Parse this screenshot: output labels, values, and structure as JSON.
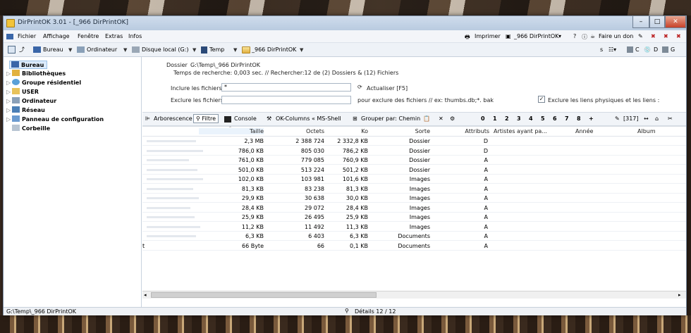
{
  "window": {
    "title": "DirPrintOK 3.01 - [_966 DirPrintOK]"
  },
  "menu": {
    "items": [
      "Fichier",
      "Affichage",
      "Fenêtre",
      "Extras",
      "Infos"
    ],
    "print": "Imprimer",
    "doc": "_966 DirPrintOK",
    "donate": "Faire un don"
  },
  "address": {
    "crumbs": [
      "Bureau",
      "Ordinateur",
      "Disque local (G:)",
      "Temp",
      "_966 DirPrintOK"
    ],
    "right_letters": [
      "C",
      "D",
      "G"
    ]
  },
  "tree": {
    "items": [
      "Bureau",
      "Bibliothèques",
      "Groupe résidentiel",
      "USER",
      "Ordinateur",
      "Réseau",
      "Panneau de configuration",
      "Corbeille"
    ]
  },
  "info": {
    "dossier_label": "Dossier",
    "dossier_value": "G:\\Temp\\_966 DirPrintOK",
    "search_time": "Temps de recherche: 0,003 sec. //  Rechercher:12 de (2) Dossiers & (12) Fichiers",
    "include_label": "Inclure les fichiers",
    "include_value": "*",
    "refresh": "Actualiser [F5]",
    "exclude_label": "Exclure les fichiers",
    "exclude_hint": "pour exclure des fichiers // ex: thumbs.db;*. bak",
    "exclude_links": "Exclure les liens physiques et les liens :"
  },
  "toolbar": {
    "tree": "Arborescence",
    "filter": "Filtre",
    "console": "Console",
    "columns": "OK-Columns « MS-Shell",
    "group": "Grouper par: Chemin",
    "digits": [
      "0",
      "1",
      "2",
      "3",
      "4",
      "5",
      "6",
      "7",
      "8",
      "+"
    ],
    "count": "[317]"
  },
  "columns": [
    "Taille",
    "Octets",
    "Ko",
    "Sorte",
    "Attributs",
    "Artistes ayant pa...",
    "Année",
    "Album"
  ],
  "rows": [
    {
      "taille": "2,3 MB",
      "octets": "2 388 724",
      "ko": "2 332,8 KB",
      "sorte": "Dossier",
      "attr": "D"
    },
    {
      "taille": "786,0 KB",
      "octets": "805 030",
      "ko": "786,2 KB",
      "sorte": "Dossier",
      "attr": "D"
    },
    {
      "taille": "761,0 KB",
      "octets": "779 085",
      "ko": "760,9 KB",
      "sorte": "Dossier",
      "attr": "A"
    },
    {
      "taille": "501,0 KB",
      "octets": "513 224",
      "ko": "501,2 KB",
      "sorte": "Dossier",
      "attr": "A"
    },
    {
      "taille": "102,0 KB",
      "octets": "103 981",
      "ko": "101,6 KB",
      "sorte": "Images",
      "attr": "A"
    },
    {
      "taille": "81,3 KB",
      "octets": "83 238",
      "ko": "81,3 KB",
      "sorte": "Images",
      "attr": "A"
    },
    {
      "taille": "29,9 KB",
      "octets": "30 638",
      "ko": "30,0 KB",
      "sorte": "Images",
      "attr": "A"
    },
    {
      "taille": "28,4 KB",
      "octets": "29 072",
      "ko": "28,4 KB",
      "sorte": "Images",
      "attr": "A"
    },
    {
      "taille": "25,9 KB",
      "octets": "26 495",
      "ko": "25,9 KB",
      "sorte": "Images",
      "attr": "A"
    },
    {
      "taille": "11,2 KB",
      "octets": "11 492",
      "ko": "11,3 KB",
      "sorte": "Images",
      "attr": "A"
    },
    {
      "taille": "6,3 KB",
      "octets": "6 403",
      "ko": "6,3 KB",
      "sorte": "Documents",
      "attr": "A"
    },
    {
      "taille": "66 Byte",
      "octets": "66",
      "ko": "0,1 KB",
      "sorte": "Documents",
      "attr": "A",
      "mark": "t"
    }
  ],
  "status": {
    "path": "G:\\Temp\\_966 DirPrintOK",
    "details": "Détails 12 / 12"
  }
}
